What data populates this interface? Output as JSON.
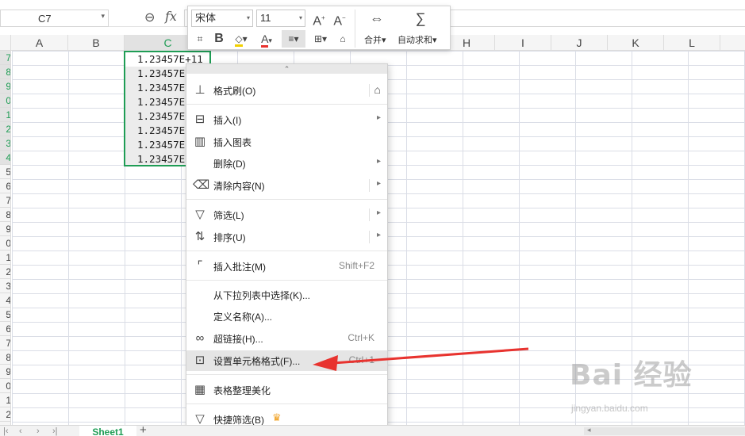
{
  "formula_bar": {
    "name_box": "C7",
    "fx": "fx"
  },
  "columns": [
    "A",
    "B",
    "C",
    "D",
    "E",
    "F",
    "G",
    "H",
    "I",
    "J",
    "K",
    "L"
  ],
  "rows": [
    "7",
    "8",
    "9",
    "0",
    "1",
    "2",
    "3",
    "4",
    "5",
    "6",
    "7",
    "8",
    "9",
    "0",
    "1",
    "2",
    "3",
    "4",
    "5",
    "6",
    "7",
    "8",
    "9",
    "0",
    "1",
    "2"
  ],
  "cells": [
    "1.23457E+11",
    "1.23457E",
    "1.23457E",
    "1.23457E",
    "1.23457E",
    "1.23457E",
    "1.23457E",
    "1.23457E"
  ],
  "mini_toolbar": {
    "font": "宋体",
    "size": "11",
    "bold": "B",
    "merge_label": "合并",
    "autosum_label": "自动求和"
  },
  "context_menu": {
    "items": [
      {
        "label": "格式刷(O)",
        "icon": "format-painter-icon"
      },
      {
        "label": "插入(I)",
        "icon": "insert-icon",
        "submenu": true
      },
      {
        "label": "插入图表",
        "icon": "chart-icon"
      },
      {
        "label": "删除(D)",
        "icon": "",
        "submenu": true
      },
      {
        "label": "清除内容(N)",
        "icon": "eraser-icon",
        "submenu": true
      },
      {
        "label": "筛选(L)",
        "icon": "filter-icon",
        "submenu": true
      },
      {
        "label": "排序(U)",
        "icon": "sort-icon",
        "submenu": true
      },
      {
        "label": "插入批注(M)",
        "icon": "comment-icon",
        "shortcut": "Shift+F2"
      },
      {
        "label": "从下拉列表中选择(K)...",
        "icon": ""
      },
      {
        "label": "定义名称(A)...",
        "icon": ""
      },
      {
        "label": "超链接(H)...",
        "icon": "link-icon",
        "shortcut": "Ctrl+K"
      },
      {
        "label": "设置单元格格式(F)...",
        "icon": "cell-format-icon",
        "shortcut": "Ctrl+1"
      },
      {
        "label": "表格整理美化",
        "icon": "beautify-icon"
      },
      {
        "label": "快捷筛选(B)",
        "icon": "quick-filter-icon"
      }
    ]
  },
  "sheet_tabs": [
    "Sheet1"
  ],
  "watermark": {
    "main": "Bai 经验",
    "sub": "jingyan.baidu.com"
  },
  "colors": {
    "selection": "#1f9d55",
    "arrow": "#e8332f"
  }
}
